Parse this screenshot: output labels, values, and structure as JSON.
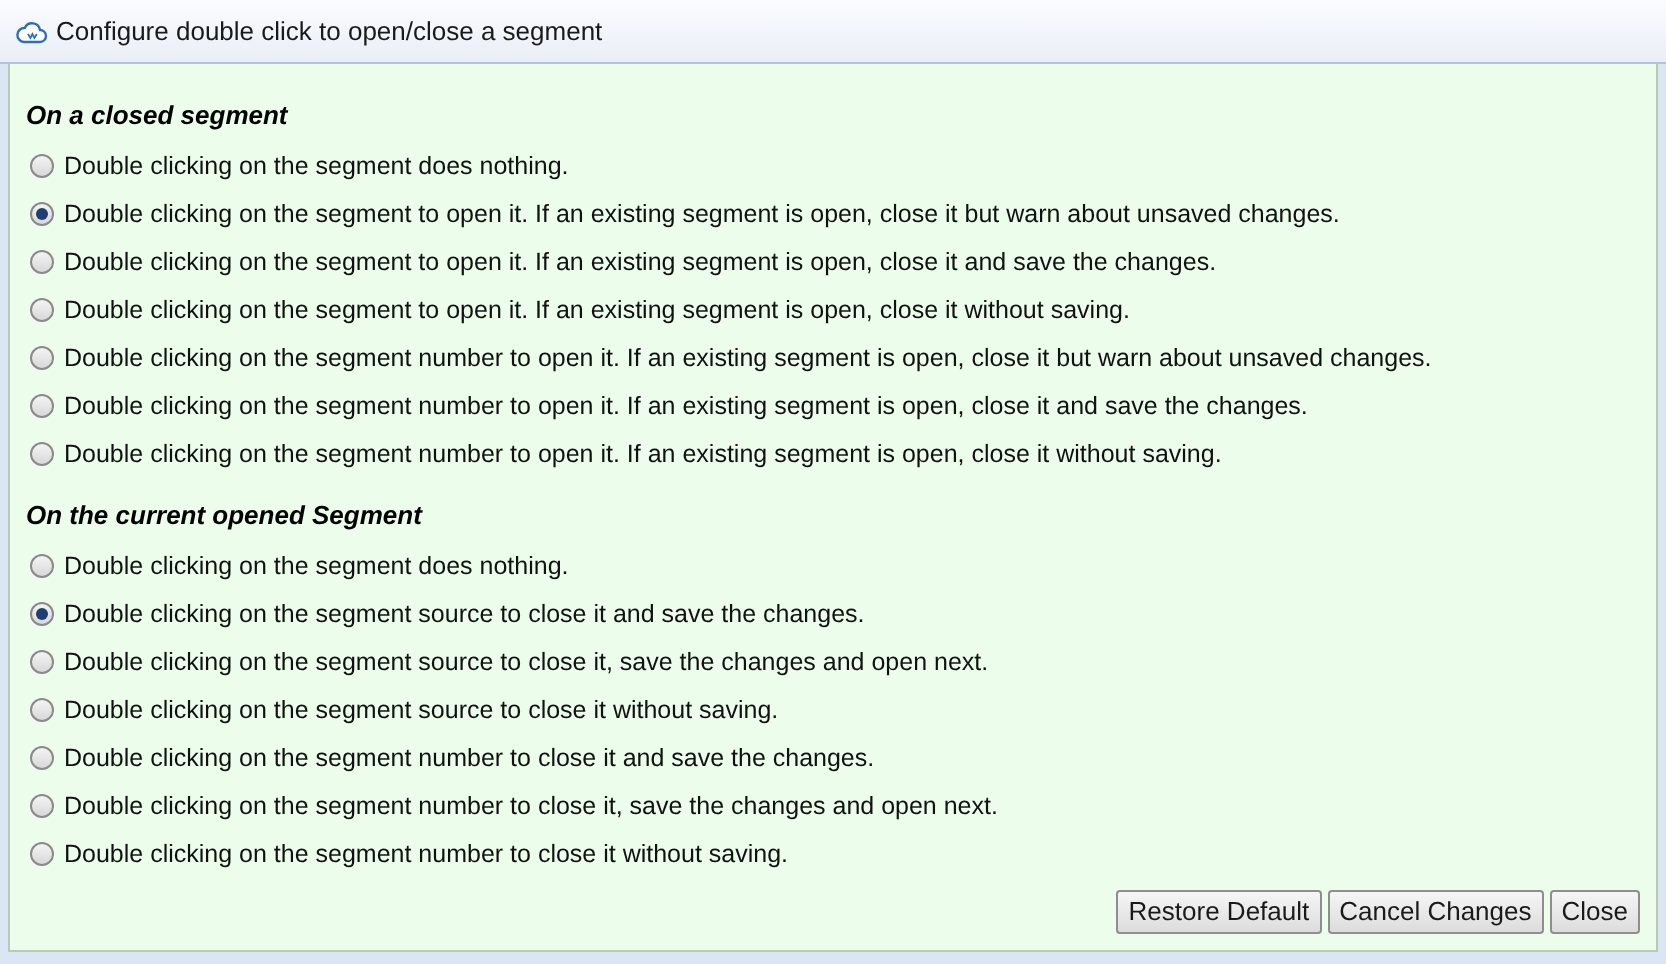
{
  "window": {
    "title": "Configure double click to open/close a segment"
  },
  "sections": [
    {
      "heading": "On a closed segment",
      "options": [
        {
          "label": "Double clicking on the segment does nothing.",
          "selected": false
        },
        {
          "label": "Double clicking on the segment to open it. If an existing segment is open, close it but warn about unsaved changes.",
          "selected": true
        },
        {
          "label": "Double clicking on the segment to open it. If an existing segment is open, close it and save the changes.",
          "selected": false
        },
        {
          "label": "Double clicking on the segment to open it. If an existing segment is open, close it without saving.",
          "selected": false
        },
        {
          "label": "Double clicking on the segment number to open it. If an existing segment is open, close it but warn about unsaved changes.",
          "selected": false
        },
        {
          "label": "Double clicking on the segment number to open it. If an existing segment is open, close it and save the changes.",
          "selected": false
        },
        {
          "label": "Double clicking on the segment number to open it. If an existing segment is open, close it without saving.",
          "selected": false
        }
      ]
    },
    {
      "heading": "On the current opened Segment",
      "options": [
        {
          "label": "Double clicking on the segment does nothing.",
          "selected": false
        },
        {
          "label": "Double clicking on the segment source to close it and save the changes.",
          "selected": true
        },
        {
          "label": "Double clicking on the segment source to close it, save the changes and open next.",
          "selected": false
        },
        {
          "label": "Double clicking on the segment source to close it without saving.",
          "selected": false
        },
        {
          "label": "Double clicking on the segment number to close it and save the changes.",
          "selected": false
        },
        {
          "label": "Double clicking on the segment number to close it, save the changes and open next.",
          "selected": false
        },
        {
          "label": "Double clicking on the segment number to close it without saving.",
          "selected": false
        }
      ]
    }
  ],
  "buttons": [
    "Restore Default",
    "Cancel Changes",
    "Close"
  ]
}
